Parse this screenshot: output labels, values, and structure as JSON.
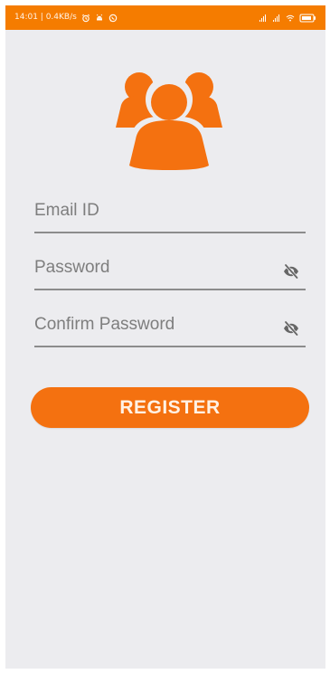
{
  "status_bar": {
    "time_speed": "14:01 | 0.4KB/s"
  },
  "form": {
    "email_placeholder": "Email ID",
    "password_placeholder": "Password",
    "confirm_password_placeholder": "Confirm Password",
    "register_label": "REGISTER"
  },
  "icons": {
    "logo": "users-group-icon",
    "password_toggle": "eye-off-icon",
    "confirm_password_toggle": "eye-off-icon"
  },
  "colors": {
    "accent": "#f57c00",
    "button": "#f47110",
    "background": "#ececef"
  }
}
